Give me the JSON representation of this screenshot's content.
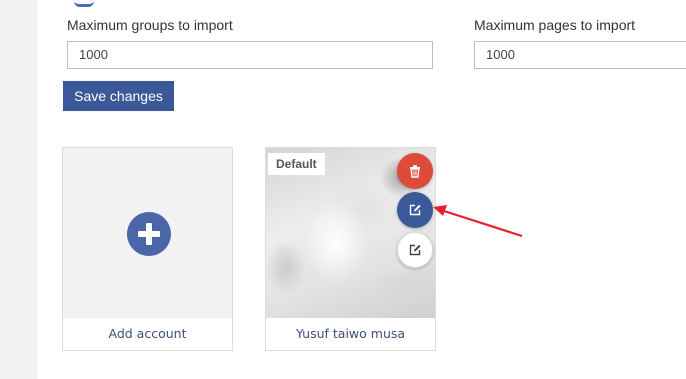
{
  "settings": {
    "max_groups_label": "Maximum groups to import",
    "max_groups_value": "1000",
    "max_pages_label": "Maximum pages to import",
    "max_pages_value": "1000",
    "save_label": "Save changes"
  },
  "accounts": {
    "add_card": {
      "label": "Add account",
      "icon": "plus-circle-icon"
    },
    "items": [
      {
        "name": "Yusuf taiwo musa",
        "badge": "Default",
        "actions": [
          {
            "icon": "trash-icon",
            "color": "#dd4b39"
          },
          {
            "icon": "edit-icon",
            "color": "#3b5998"
          },
          {
            "icon": "edit-icon",
            "color": "#ffffff"
          }
        ]
      }
    ]
  },
  "colors": {
    "accent": "#3b5998",
    "danger": "#dd4b39",
    "annotation_arrow": "#e8202a"
  }
}
